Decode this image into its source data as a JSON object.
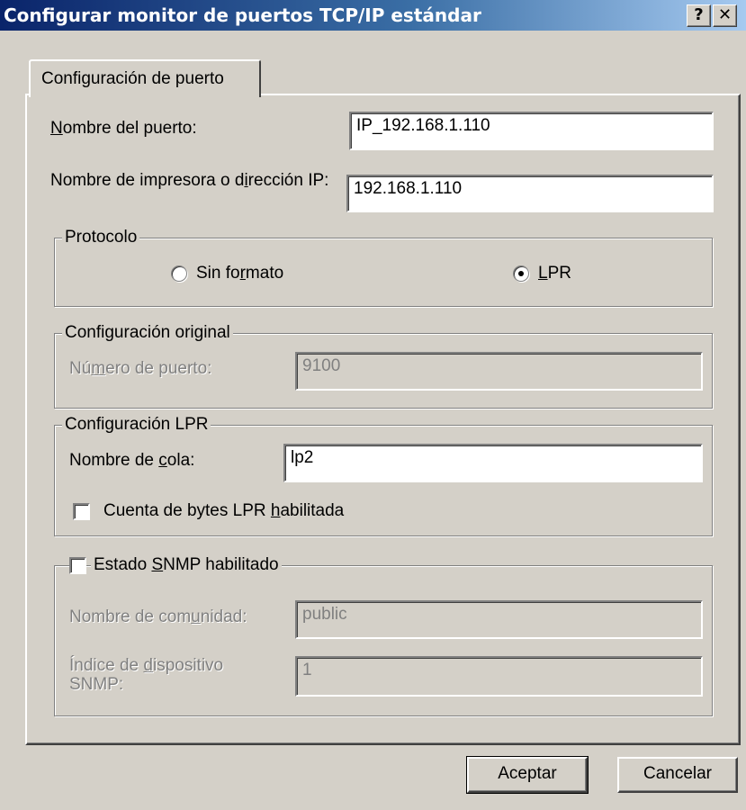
{
  "window": {
    "title": "Configurar monitor de puertos TCP/IP estándar",
    "help_glyph": "?",
    "close_glyph": "✕"
  },
  "tab": {
    "label": "Configuración de puerto"
  },
  "port_name": {
    "label_pre": "",
    "label_key": "N",
    "label_post": "ombre del puerto:",
    "value": "IP_192.168.1.110"
  },
  "printer_address": {
    "label_pre": "Nombre de impresora o d",
    "label_key": "i",
    "label_post": "rección IP:",
    "value": "192.168.1.110"
  },
  "protocol": {
    "legend": "Protocolo",
    "raw": {
      "label_pre": "Sin fo",
      "label_key": "r",
      "label_post": "mato",
      "selected": false
    },
    "lpr": {
      "label_pre": "",
      "label_key": "L",
      "label_post": "PR",
      "selected": true
    }
  },
  "raw_settings": {
    "legend": "Configuración original",
    "port_number": {
      "label_pre": "Nú",
      "label_key": "m",
      "label_post": "ero de puerto:",
      "value": "9100"
    }
  },
  "lpr_settings": {
    "legend": "Configuración LPR",
    "queue_name": {
      "label_pre": "Nombre de ",
      "label_key": "c",
      "label_post": "ola:",
      "value": "lp2"
    },
    "byte_count": {
      "label_pre": "Cuenta de bytes LPR ",
      "label_key": "h",
      "label_post": "abilitada",
      "checked": false
    }
  },
  "snmp": {
    "checkbox": {
      "label_pre": "Estado ",
      "label_key": "S",
      "label_post": "NMP habilitado",
      "checked": false
    },
    "community": {
      "label_pre": "Nombre de com",
      "label_key": "u",
      "label_post": "nidad:",
      "value": "public"
    },
    "device_index": {
      "label_pre": "Índice de ",
      "label_key": "d",
      "label_post": "ispositivo SNMP:",
      "value": "1"
    }
  },
  "buttons": {
    "ok": "Aceptar",
    "cancel": "Cancelar"
  }
}
